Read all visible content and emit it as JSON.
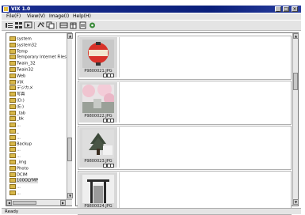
{
  "window": {
    "title": "VIX 1.0",
    "minimize": "_",
    "maximize": "□",
    "close": "×"
  },
  "menu": {
    "items": [
      "File(F)",
      "View(V)",
      "Image(I)",
      "Help(H)"
    ]
  },
  "toolbar": {
    "buttons": [
      "view-list-icon",
      "view-thumbs-icon",
      "slideshow-icon",
      "rotate-icon",
      "copy-icon",
      "move-icon",
      "delete-icon",
      "print-icon",
      "settings-icon"
    ]
  },
  "tree": {
    "items": [
      {
        "label": "system"
      },
      {
        "label": "system32"
      },
      {
        "label": "Temp"
      },
      {
        "label": "Temporary Internet Files"
      },
      {
        "label": "Twain_32"
      },
      {
        "label": "Twain32"
      },
      {
        "label": "Web"
      },
      {
        "label": "VIX"
      },
      {
        "label": "デジカメ"
      },
      {
        "label": "写真"
      },
      {
        "label": "(D:)"
      },
      {
        "label": "(E:)"
      },
      {
        "label": "_tab"
      },
      {
        "label": "_bk"
      },
      {
        "label": "..."
      },
      {
        "label": "_"
      },
      {
        "label": "..."
      },
      {
        "label": "Backup"
      },
      {
        "label": "..."
      },
      {
        "label": "..."
      },
      {
        "label": "_img"
      },
      {
        "label": "Photo"
      },
      {
        "label": "DCIM"
      },
      {
        "label": "100OLYMP"
      },
      {
        "label": "..."
      },
      {
        "label": "..."
      }
    ]
  },
  "gallery": {
    "thumbnails": [
      {
        "filename": "P9800021.JPG",
        "subject": "red-lantern"
      },
      {
        "filename": "P9800022.JPG",
        "subject": "cherry-blossoms"
      },
      {
        "filename": "P9800023.JPG",
        "subject": "tree-building"
      },
      {
        "filename": "P9800024.JPG",
        "subject": "shrine-gate"
      }
    ]
  },
  "status": {
    "text": "Ready"
  },
  "colors": {
    "titlebar": "#1a2d8f",
    "chrome": "#e4e4e4",
    "folder": "#d8b84a"
  }
}
